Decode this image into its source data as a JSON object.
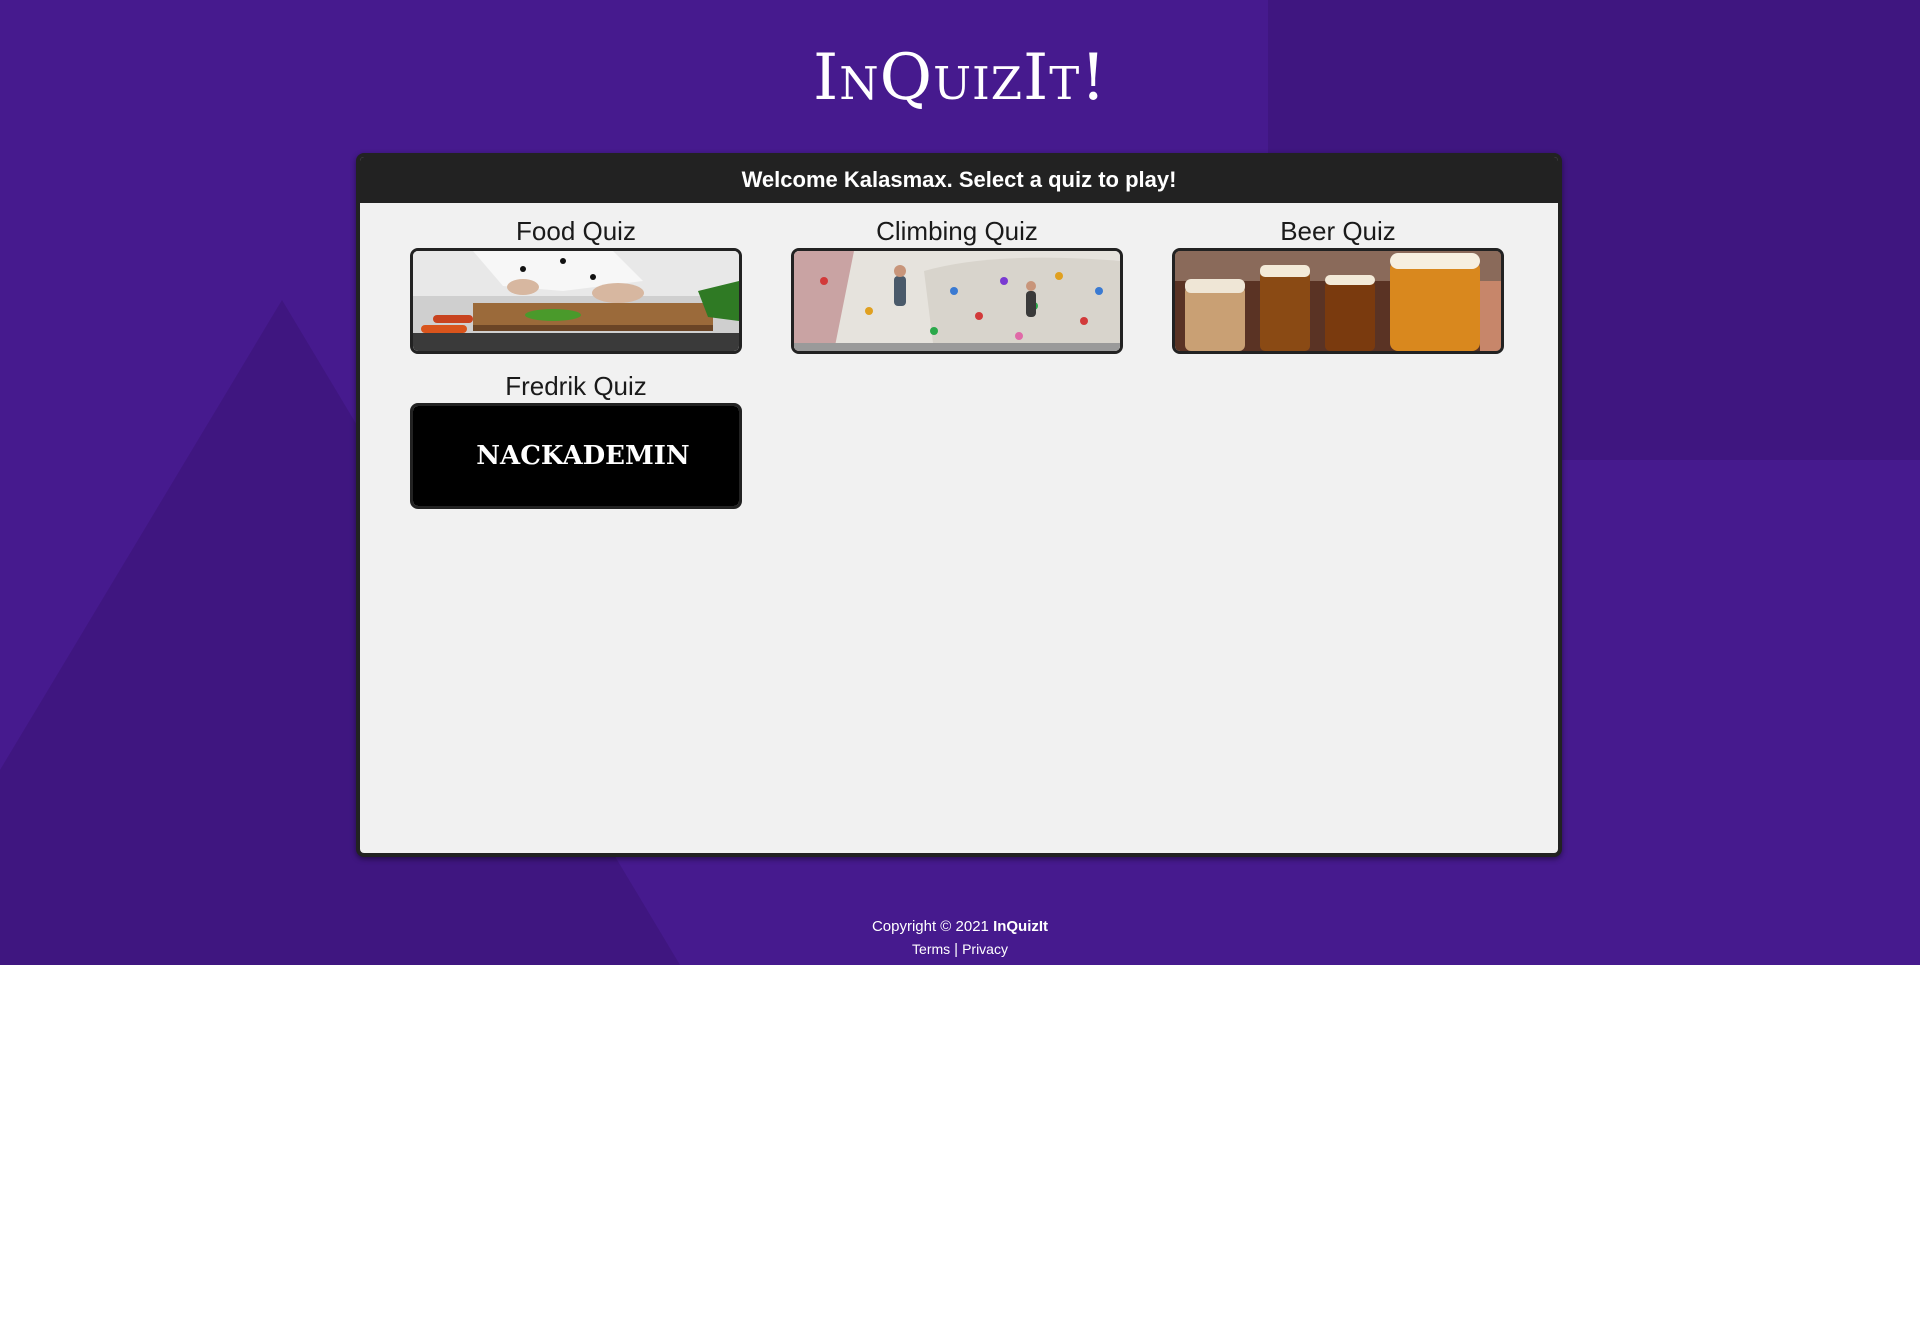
{
  "header": {
    "logo_text": "InQuizIt!"
  },
  "panel": {
    "welcome_text": "Welcome Kalasmax. Select a quiz to play!"
  },
  "quizzes": [
    {
      "title": "Food Quiz",
      "thumb_icon": "chef-cutting-board-image"
    },
    {
      "title": "Climbing Quiz",
      "thumb_icon": "climbing-wall-image"
    },
    {
      "title": "Beer Quiz",
      "thumb_icon": "beer-glasses-image"
    },
    {
      "title": "Fredrik Quiz",
      "thumb_icon": "nackademin-logo-image",
      "thumb_text": "NACKADEMIN"
    }
  ],
  "footer": {
    "copyright_text": "Copyright © 2021",
    "brand_text": "InQuizIt",
    "terms_label": "Terms",
    "separator": "|",
    "privacy_label": "Privacy"
  },
  "colors": {
    "background": "#461a8e",
    "background_shade": "#3f1680",
    "panel_header": "#222222",
    "panel_body": "#f1f1f1",
    "text_light": "#ffffff"
  }
}
